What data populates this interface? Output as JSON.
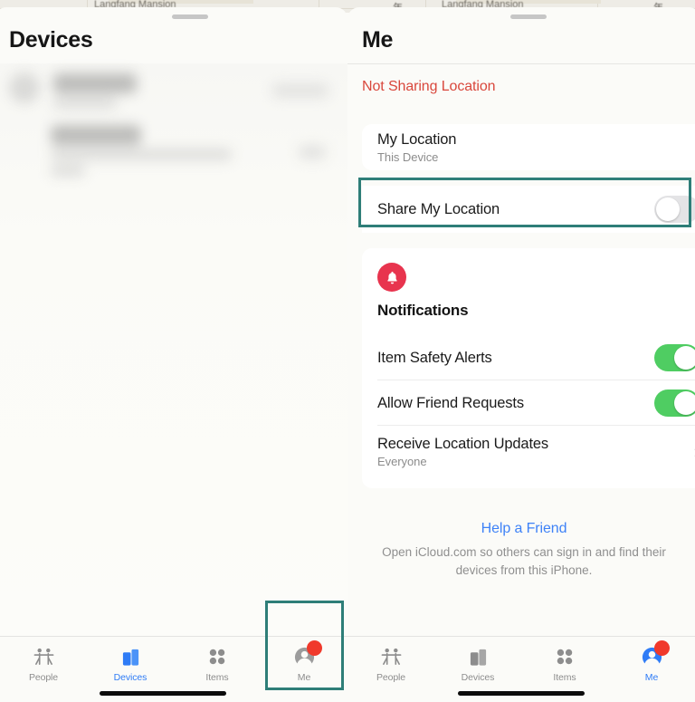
{
  "map": {
    "label_left": "Langfang Mansion",
    "label_right": "Langfang Mansion",
    "pin_left": "年",
    "pin_right": "年"
  },
  "left_panel": {
    "title": "Devices",
    "grabber": "sheet-grabber",
    "content_state": "blurred-device-list",
    "tabbar": {
      "tabs": [
        {
          "label": "People",
          "icon": "people-icon",
          "active": false,
          "badge": false
        },
        {
          "label": "Devices",
          "icon": "devices-icon",
          "active": true,
          "badge": false
        },
        {
          "label": "Items",
          "icon": "items-icon",
          "active": false,
          "badge": false
        },
        {
          "label": "Me",
          "icon": "me-icon",
          "active": false,
          "badge": true
        }
      ]
    }
  },
  "right_panel": {
    "title": "Me",
    "status": "Not Sharing Location",
    "status_color": "#d9473c",
    "my_location": {
      "title": "My Location",
      "subtitle": "This Device"
    },
    "share_my_location": {
      "label": "Share My Location",
      "toggle_state": "off"
    },
    "notifications": {
      "icon": "bell-icon",
      "icon_color": "#e8344e",
      "heading": "Notifications",
      "rows": [
        {
          "label": "Item Safety Alerts",
          "type": "toggle",
          "state": "on"
        },
        {
          "label": "Allow Friend Requests",
          "type": "toggle",
          "state": "on"
        },
        {
          "label": "Receive Location Updates",
          "type": "disclosure",
          "value": "Everyone"
        }
      ]
    },
    "footer": {
      "link": "Help a Friend",
      "note": "Open iCloud.com so others can sign in and find their devices from this iPhone."
    },
    "tabbar": {
      "tabs": [
        {
          "label": "People",
          "icon": "people-icon",
          "active": false,
          "badge": false
        },
        {
          "label": "Devices",
          "icon": "devices-icon",
          "active": false,
          "badge": false
        },
        {
          "label": "Items",
          "icon": "items-icon",
          "active": false,
          "badge": false
        },
        {
          "label": "Me",
          "icon": "me-icon",
          "active": true,
          "badge": true
        }
      ]
    }
  },
  "highlights": {
    "accent_color": "#2e7e78",
    "boxes": [
      {
        "target": "share-my-location-row"
      },
      {
        "target": "me-tab-left-tabbar"
      }
    ]
  }
}
